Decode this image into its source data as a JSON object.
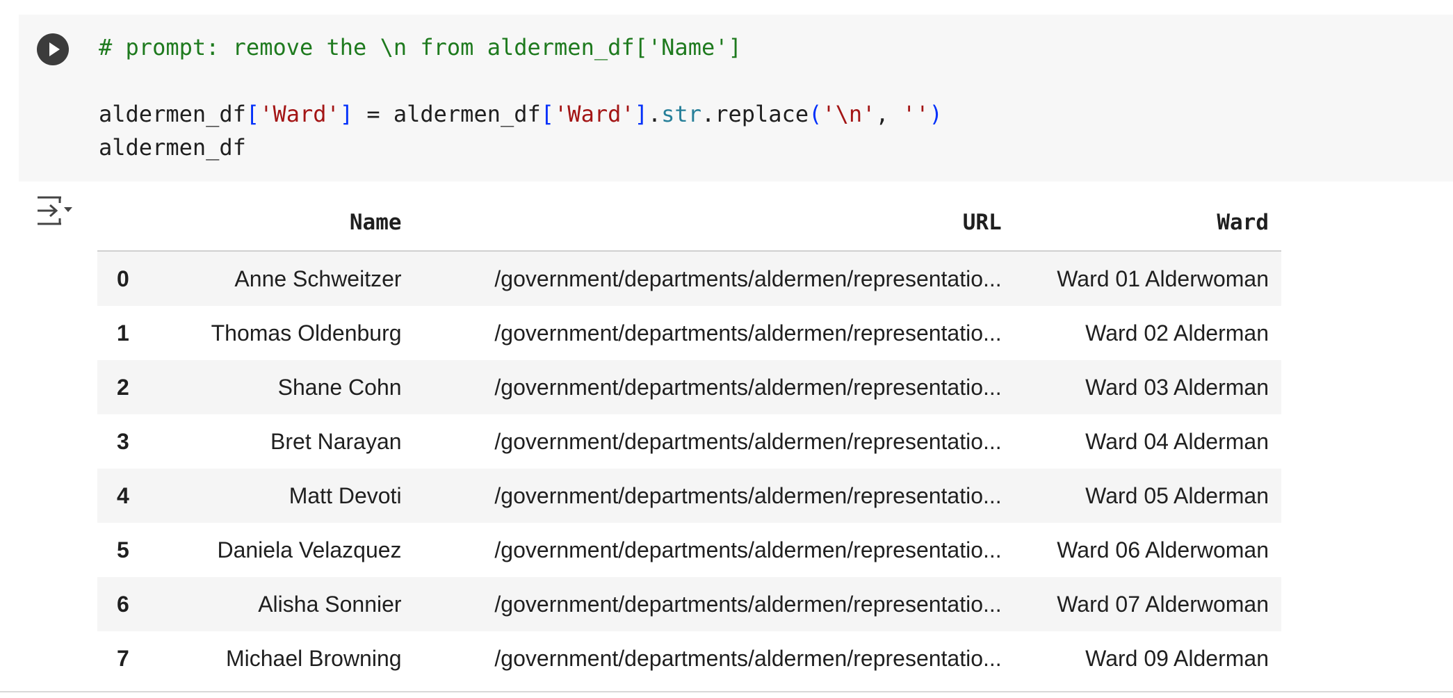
{
  "cell": {
    "code_lines": [
      [
        {
          "t": "# prompt: remove the \\n from aldermen_df['Name']",
          "c": "comment"
        }
      ],
      [],
      [
        {
          "t": "aldermen_df",
          "c": ""
        },
        {
          "t": "[",
          "c": "brk"
        },
        {
          "t": "'Ward'",
          "c": "str"
        },
        {
          "t": "]",
          "c": "brk"
        },
        {
          "t": " = aldermen_df",
          "c": ""
        },
        {
          "t": "[",
          "c": "brk"
        },
        {
          "t": "'Ward'",
          "c": "str"
        },
        {
          "t": "]",
          "c": "brk"
        },
        {
          "t": ".",
          "c": ""
        },
        {
          "t": "str",
          "c": "attr"
        },
        {
          "t": ".replace",
          "c": ""
        },
        {
          "t": "(",
          "c": "brk"
        },
        {
          "t": "'\\n'",
          "c": "str"
        },
        {
          "t": ", ",
          "c": ""
        },
        {
          "t": "''",
          "c": "str"
        },
        {
          "t": ")",
          "c": "brk"
        }
      ],
      [
        {
          "t": "aldermen_df",
          "c": ""
        }
      ]
    ]
  },
  "icons": {
    "run": "play-icon",
    "output_menu": "output-actions-icon"
  },
  "output": {
    "columns": [
      "",
      "Name",
      "URL",
      "Ward"
    ],
    "rows": [
      [
        "0",
        "Anne Schweitzer",
        "/government/departments/aldermen/representatio...",
        "Ward 01 Alderwoman"
      ],
      [
        "1",
        "Thomas Oldenburg",
        "/government/departments/aldermen/representatio...",
        "Ward 02 Alderman"
      ],
      [
        "2",
        "Shane Cohn",
        "/government/departments/aldermen/representatio...",
        "Ward 03 Alderman"
      ],
      [
        "3",
        "Bret Narayan",
        "/government/departments/aldermen/representatio...",
        "Ward 04 Alderman"
      ],
      [
        "4",
        "Matt Devoti",
        "/government/departments/aldermen/representatio...",
        "Ward 05 Alderman"
      ],
      [
        "5",
        "Daniela Velazquez",
        "/government/departments/aldermen/representatio...",
        "Ward 06 Alderwoman"
      ],
      [
        "6",
        "Alisha Sonnier",
        "/government/departments/aldermen/representatio...",
        "Ward 07 Alderwoman"
      ],
      [
        "7",
        "Michael Browning",
        "/government/departments/aldermen/representatio...",
        "Ward 09 Alderman"
      ]
    ]
  },
  "colors": {
    "cell_bg": "#f7f7f7",
    "comment": "#1e7a1e",
    "string": "#a31515",
    "bracket": "#0431fa",
    "attribute": "#267f99"
  }
}
